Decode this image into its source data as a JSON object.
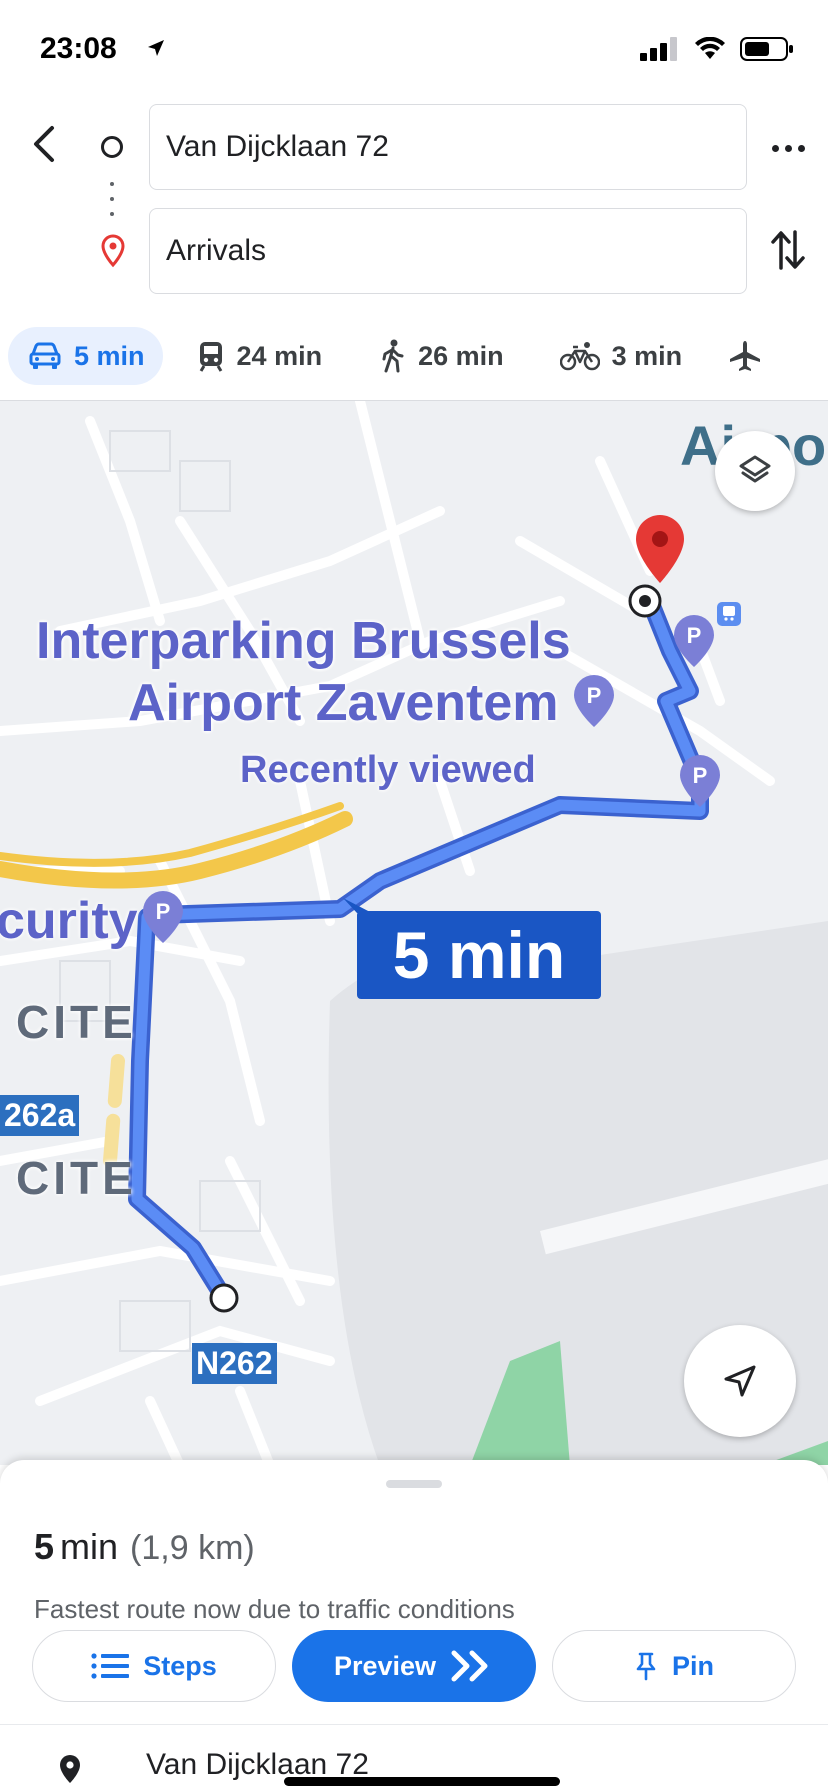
{
  "status_bar": {
    "time": "23:08"
  },
  "directions": {
    "from": "Van Dijcklaan 72",
    "to": "Arrivals"
  },
  "modes": [
    {
      "name": "car-icon",
      "label": "5 min",
      "active": true
    },
    {
      "name": "transit-icon",
      "label": "24 min"
    },
    {
      "name": "walk-icon",
      "label": "26 min"
    },
    {
      "name": "bike-icon",
      "label": "3 min"
    },
    {
      "name": "flight-icon",
      "label": ""
    }
  ],
  "map": {
    "poi_line1": "Interparking Brussels",
    "poi_line2": "Airport Zaventem",
    "poi_recent": "Recently viewed",
    "airport_partial": "Airpo",
    "security_partial": "curity",
    "cite1": "CITE",
    "cite2": "CITE",
    "road_n262a": "262a",
    "road_n262": "N262",
    "eta": "5 min",
    "colors": {
      "route": "#4a7cf0",
      "route_outline": "#3b62cf",
      "highway": "#f5c842",
      "destination_pin": "#e53935",
      "parking": "#7b7fd6"
    }
  },
  "sheet": {
    "duration_value": "5",
    "duration_unit": "min",
    "distance": "(1,9 km)",
    "reason": "Fastest route now due to traffic conditions",
    "steps_label": "Steps",
    "preview_label": "Preview",
    "pin_label": "Pin",
    "first_step": "Van Dijcklaan 72"
  }
}
